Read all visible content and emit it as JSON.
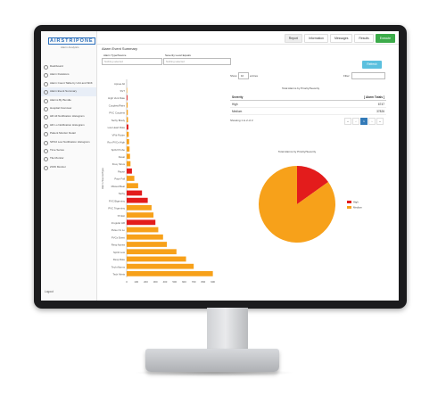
{
  "app": {
    "logo": "AIRSTRIPONE",
    "logo_sub": "Alarm Analytics"
  },
  "sidebar": {
    "items": [
      {
        "label": "Dashboard"
      },
      {
        "label": "Alarm Durations"
      },
      {
        "label": "Alarm Count Table by Unit and Shift"
      },
      {
        "label": "Alarm Event Summary"
      },
      {
        "label": "Alarms By Bundle"
      },
      {
        "label": "Hospital Overview"
      },
      {
        "label": "HR All Notification Histogram"
      },
      {
        "label": "HR Lo Notification Histogram"
      },
      {
        "label": "Patient Monitor Detail"
      },
      {
        "label": "SPO2 Low Notification Histogram"
      },
      {
        "label": "Time Series"
      },
      {
        "label": "Tile Monitor"
      },
      {
        "label": "ZOW Monitor"
      }
    ],
    "logout": "Logout"
  },
  "topbar": {
    "tabs": [
      "Report",
      "Information",
      "Messages",
      "Results",
      "Execute"
    ]
  },
  "page": {
    "title": "Alarm Event Summary",
    "filter1_label": "Alarm Type/Source",
    "filter1_value": "Nothing selected",
    "filter2_label": "Severity Level Equals",
    "filter2_value": "Nothing selected",
    "refresh": "Refresh"
  },
  "summary": {
    "show_label": "Show",
    "show_value": "10",
    "entries_label": "entries",
    "filter_label": "Filter:",
    "caption": "Total Alarms by Priority/Severity",
    "headers": [
      "Severity",
      "[ Alarm Totals ]"
    ],
    "rows": [
      [
        "High",
        "6747"
      ],
      [
        "Medium",
        "37826"
      ]
    ],
    "footer": "Showing 1 to 2 of 2",
    "pager": [
      "«",
      "‹",
      "1",
      "›",
      "»"
    ]
  },
  "colors": {
    "high": "#e31c1c",
    "medium": "#f7a11a",
    "bar_orange": "#f7a11a",
    "bar_red": "#e31c1c",
    "accent": "#3cab4a"
  },
  "chart_data": [
    {
      "type": "bar",
      "orientation": "horizontal",
      "ylabel": "Alarm Source/Type",
      "categories": [
        "Apnea Alt",
        "SVT",
        "High Vent Rate",
        "Couplets/Pairs",
        "PVC Couplets",
        "Tachy Brady",
        "Low Heart Rate",
        "VFib Flutter",
        "Run PVCs High",
        "SpO2 Probe",
        "Desat",
        "Freq. Sinus",
        "Pause",
        "Pace Fail",
        "Missed Beat",
        "Tachy",
        "PVC Bigeminy",
        "PVC Trigeminy",
        "ST-Ext",
        "Irregular HR",
        "Pulse Ox Lo",
        "PVCs Event",
        "Resp Apnea",
        "SpO2 Low",
        "Resp Rate",
        "Tech Alarms",
        "Tech Alerts"
      ],
      "values": [
        0,
        5,
        8,
        10,
        12,
        14,
        18,
        22,
        26,
        30,
        35,
        40,
        55,
        80,
        120,
        160,
        220,
        260,
        280,
        300,
        330,
        380,
        420,
        520,
        620,
        700,
        900
      ],
      "bar_colors": [
        "orange",
        "orange",
        "red",
        "orange",
        "orange",
        "orange",
        "red",
        "orange",
        "orange",
        "orange",
        "orange",
        "orange",
        "red",
        "orange",
        "orange",
        "red",
        "red",
        "orange",
        "orange",
        "red",
        "orange",
        "orange",
        "orange",
        "orange",
        "orange",
        "orange",
        "orange"
      ],
      "xticks": [
        "0",
        "100",
        "200",
        "300",
        "400",
        "500",
        "600",
        "700",
        "800",
        "900"
      ],
      "xlim": [
        0,
        950
      ]
    },
    {
      "type": "pie",
      "title": "Total Alarms by Priority/Severity",
      "labels": [
        "High",
        "Medium"
      ],
      "values": [
        6747,
        37826
      ],
      "colors": [
        "#e31c1c",
        "#f7a11a"
      ]
    }
  ]
}
